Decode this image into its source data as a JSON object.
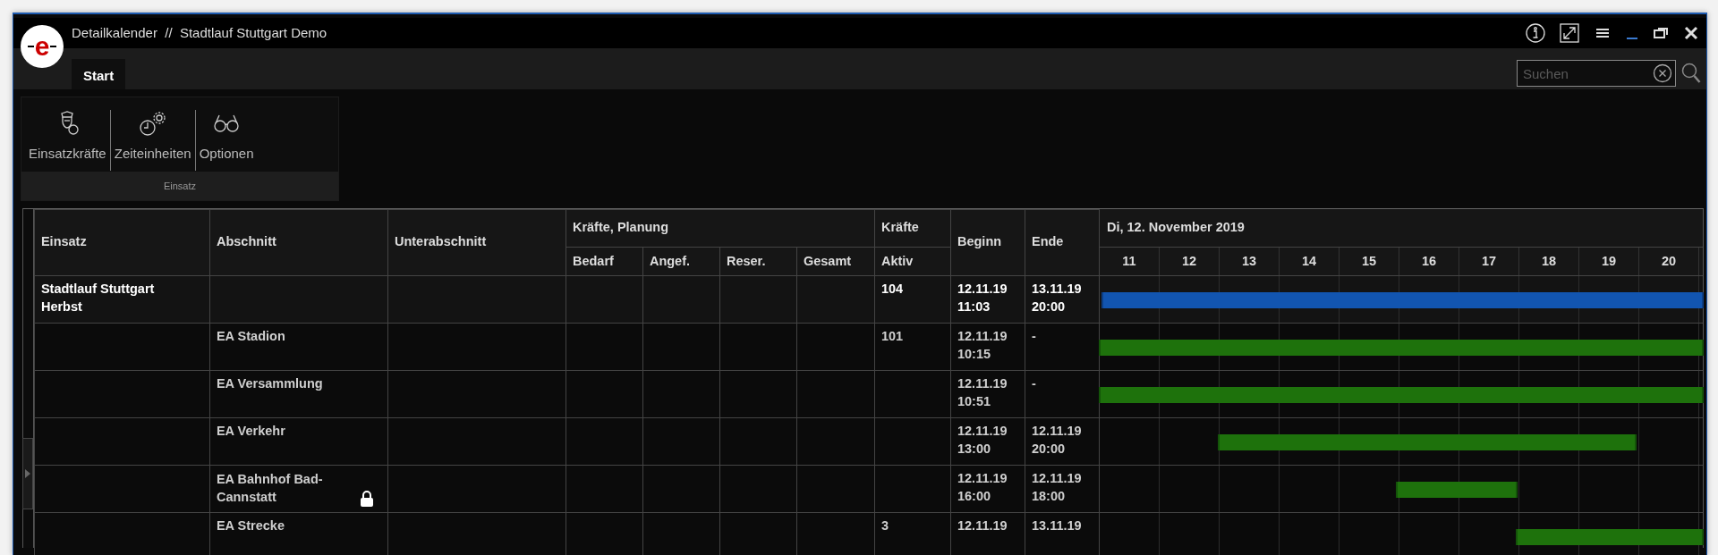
{
  "window": {
    "logo": "e",
    "title": "Detailkalender  //  Stadtlauf Stuttgart Demo"
  },
  "tabs": [
    {
      "label": "Start",
      "selected": true
    }
  ],
  "search": {
    "placeholder": "Suchen"
  },
  "ribbon": {
    "groups": [
      {
        "label": "Einsatz",
        "buttons": [
          {
            "label": "Einsatzkräfte",
            "kind": "officer"
          },
          {
            "label": "Zeiteinheiten",
            "kind": "clock"
          },
          {
            "label": "Optionen",
            "kind": "glasses"
          }
        ]
      }
    ]
  },
  "table": {
    "columns": [
      {
        "label": "Einsatz"
      },
      {
        "label": "Abschnitt"
      },
      {
        "label": "Unterabschnitt"
      },
      {
        "group": "Kräfte, Planung",
        "columns": [
          {
            "label": "Bedarf"
          },
          {
            "label": "Angef."
          },
          {
            "label": "Reser."
          },
          {
            "label": "Gesamt"
          }
        ]
      },
      {
        "group": "Kräfte",
        "columns": [
          {
            "label": "Aktiv"
          }
        ]
      },
      {
        "label": "Beginn"
      },
      {
        "label": "Ende"
      }
    ],
    "rows": [
      {
        "kind": "einsatz",
        "einsatz": "Stadtlauf Stuttgart Herbst",
        "aktiv": "104",
        "beginn": {
          "date": "12.11.19",
          "time": "11:03"
        },
        "ende": {
          "date": "13.11.19",
          "time": "20:00"
        },
        "bar": {
          "from": {
            "level": 0.005
          },
          "to": {
            "level": 1
          }
        }
      },
      {
        "kind": "abschnitt",
        "abschnitt": "EA Stadion",
        "aktiv": "101",
        "beginn": {
          "date": "12.11.19",
          "time": "10:15"
        },
        "ende": {
          "date": "-"
        },
        "bar": {
          "from": {
            "level": 0
          },
          "to": {
            "level": 1
          }
        }
      },
      {
        "kind": "abschnitt",
        "abschnitt": "EA Versammlung",
        "beginn": {
          "date": "12.11.19",
          "time": "10:51"
        },
        "ende": {
          "date": "-"
        },
        "bar": {
          "from": {
            "level": 0
          },
          "to": {
            "level": 1
          }
        }
      },
      {
        "kind": "abschnitt",
        "abschnitt": "EA Verkehr",
        "beginn": {
          "date": "12.11.19",
          "time": "13:00"
        },
        "ende": {
          "date": "12.11.19",
          "time": "20:00"
        },
        "bar": {
          "from": {
            "level": 0.197
          },
          "to": {
            "level": 0.888
          }
        }
      },
      {
        "kind": "abschnitt",
        "abschnitt": "EA Bahnhof Bad-Cannstatt",
        "locked": true,
        "beginn": {
          "date": "12.11.19",
          "time": "16:00"
        },
        "ende": {
          "date": "12.11.19",
          "time": "18:00"
        },
        "bar": {
          "from": {
            "level": 0.493
          },
          "to": {
            "level": 0.691
          }
        }
      },
      {
        "kind": "abschnitt",
        "abschnitt": "EA Strecke",
        "aktiv": "3",
        "beginn": {
          "date": "12.11.19"
        },
        "ende": {
          "date": "13.11.19"
        },
        "bar": {
          "from": {
            "level": 0.691
          },
          "to": {
            "level": 1
          }
        }
      }
    ]
  },
  "timeline": {
    "date": "Di, 12. November 2019",
    "hours": [
      "11",
      "12",
      "13",
      "14",
      "15",
      "16",
      "17",
      "18",
      "19",
      "20"
    ]
  }
}
